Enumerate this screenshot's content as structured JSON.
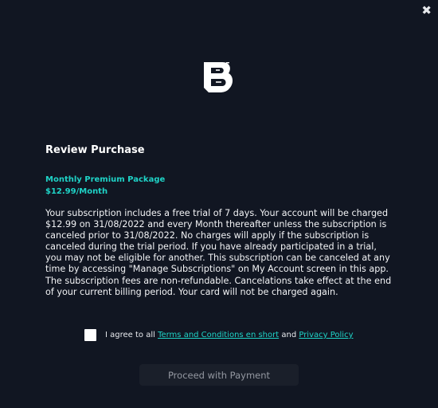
{
  "close_icon": "close-icon",
  "logo_icon": "brand-logo",
  "title": "Review Purchase",
  "package": {
    "name": "Monthly Premium Package",
    "price": "$12.99/Month"
  },
  "description": "Your subscription includes a free trial of 7 days. Your account will be charged $12.99 on 31/08/2022 and every Month thereafter unless the subscription is canceled prior to 31/08/2022. No charges will apply if the subscription is canceled during the trial period. If you have already participated in a trial, you may not be eligible for another. This subscription can be canceled at any time by accessing \"Manage Subscriptions\" on My Account screen in this app. The subscription fees are non-refundable. Cancelations take effect at the end of your current billing period. Your card will not be charged again.",
  "agreement": {
    "prefix": "I agree to all ",
    "terms_link": "Terms and Conditions en short",
    "connector": " and ",
    "privacy_link": "Privacy Policy",
    "checked": false
  },
  "proceed_label": "Proceed with Payment",
  "colors": {
    "background": "#111622",
    "accent": "#1fd3c7",
    "button_bg": "#1a1f2a",
    "button_text": "#9498a1"
  }
}
